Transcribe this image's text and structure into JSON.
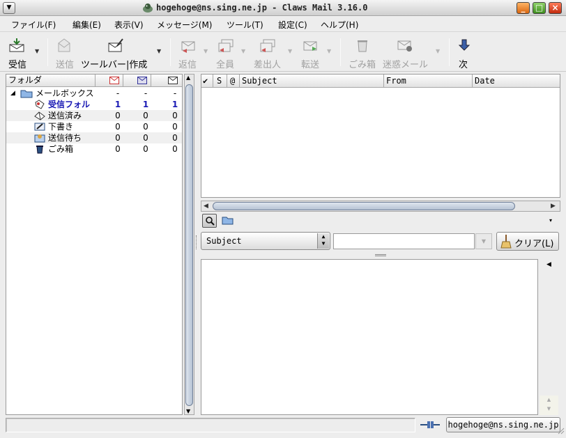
{
  "window": {
    "title": "hogehoge@ns.sing.ne.jp - Claws Mail 3.16.0",
    "menu_icon": "chevron-down-icon",
    "minimize_symbol": "_",
    "maximize_symbol": "□",
    "close_symbol": "×"
  },
  "menubar": {
    "items": [
      "ファイル(F)",
      "編集(E)",
      "表示(V)",
      "メッセージ(M)",
      "ツール(T)",
      "設定(C)",
      "ヘルプ(H)"
    ]
  },
  "toolbar": {
    "receive": "受信",
    "send": "送信",
    "compose": "ツールバー|作成",
    "reply": "返信",
    "reply_all": "全員",
    "reply_sender": "差出人",
    "forward": "転送",
    "trash": "ごみ箱",
    "spam": "迷惑メール",
    "next": "次"
  },
  "folder_pane": {
    "header_name": "フォルダ",
    "header_icons": [
      "unread-mail-icon",
      "new-mail-icon",
      "total-mail-icon"
    ],
    "rows": [
      {
        "name": "メールボックス",
        "unread": "-",
        "new": "-",
        "total": "-",
        "icon": "mailbox-folder-icon"
      },
      {
        "name": "受信フォル",
        "unread": "1",
        "new": "1",
        "total": "1",
        "icon": "inbox-icon"
      },
      {
        "name": "送信済み",
        "unread": "0",
        "new": "0",
        "total": "0",
        "icon": "sent-icon"
      },
      {
        "name": "下書き",
        "unread": "0",
        "new": "0",
        "total": "0",
        "icon": "drafts-icon"
      },
      {
        "name": "送信待ち",
        "unread": "0",
        "new": "0",
        "total": "0",
        "icon": "queue-icon"
      },
      {
        "name": "ごみ箱",
        "unread": "0",
        "new": "0",
        "total": "0",
        "icon": "trash-icon"
      }
    ]
  },
  "message_list": {
    "col_check": "✔",
    "col_status": "S",
    "col_attach": "@",
    "col_subject": "Subject",
    "col_from": "From",
    "col_date": "Date",
    "scroll_left": "◀",
    "scroll_right": "▶"
  },
  "quick_search": {
    "search_type": "Subject",
    "input_value": "",
    "clear_label": "クリア(L)",
    "more_symbol": "▾"
  },
  "status_bar": {
    "account": "hogehoge@ns.sing.ne.jp"
  },
  "colors": {
    "bold_folder": "#1a1ab4",
    "accent": "#6f7f98"
  }
}
